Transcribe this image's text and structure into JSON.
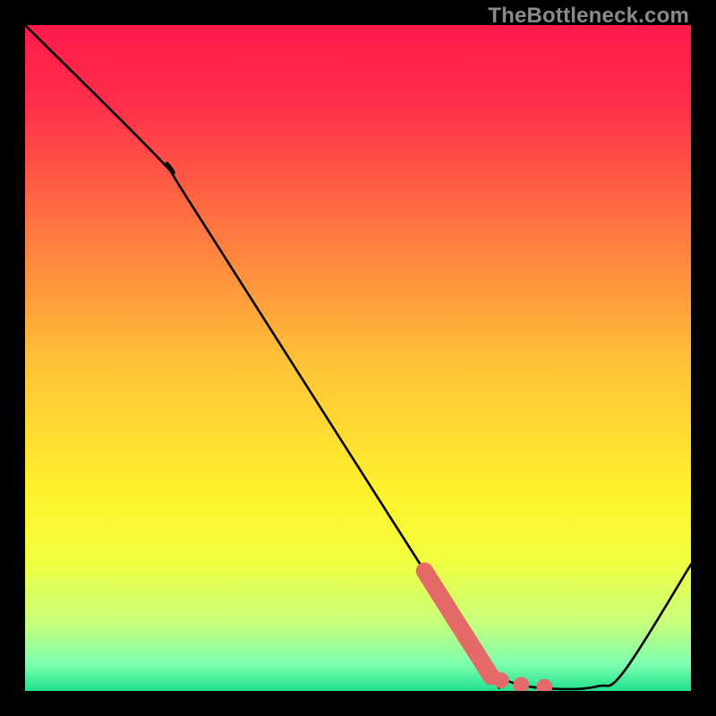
{
  "watermark": "TheBottleneck.com",
  "chart_data": {
    "type": "line",
    "title": "",
    "xlabel": "",
    "ylabel": "",
    "xlim": [
      0,
      100
    ],
    "ylim": [
      0,
      100
    ],
    "gradient_stops": [
      {
        "offset": 0.0,
        "color": "#ff1a4b"
      },
      {
        "offset": 0.12,
        "color": "#ff2f4a"
      },
      {
        "offset": 0.5,
        "color": "#ffc038"
      },
      {
        "offset": 0.7,
        "color": "#fff12d"
      },
      {
        "offset": 0.8,
        "color": "#f3ff3e"
      },
      {
        "offset": 0.9,
        "color": "#c6ff7d"
      },
      {
        "offset": 0.96,
        "color": "#7dffb0"
      },
      {
        "offset": 1.0,
        "color": "#1fe08e"
      }
    ],
    "curve": [
      {
        "x": 0,
        "y": 100
      },
      {
        "x": 21,
        "y": 79
      },
      {
        "x": 25,
        "y": 73
      },
      {
        "x": 67,
        "y": 7
      },
      {
        "x": 70,
        "y": 3
      },
      {
        "x": 74,
        "y": 1
      },
      {
        "x": 80,
        "y": 0.3
      },
      {
        "x": 86,
        "y": 0.7
      },
      {
        "x": 90,
        "y": 3
      },
      {
        "x": 100,
        "y": 19
      }
    ],
    "highlight_segment": {
      "x1": 60,
      "y1": 18,
      "x2": 70,
      "y2": 2.2,
      "color": "#e46a67",
      "width": 2.6
    },
    "dots": [
      {
        "x": 71.5,
        "y": 1.6
      },
      {
        "x": 74.5,
        "y": 0.9
      },
      {
        "x": 78.0,
        "y": 0.6
      }
    ],
    "dot_style": {
      "color": "#e46a67",
      "radius": 1.2
    }
  }
}
